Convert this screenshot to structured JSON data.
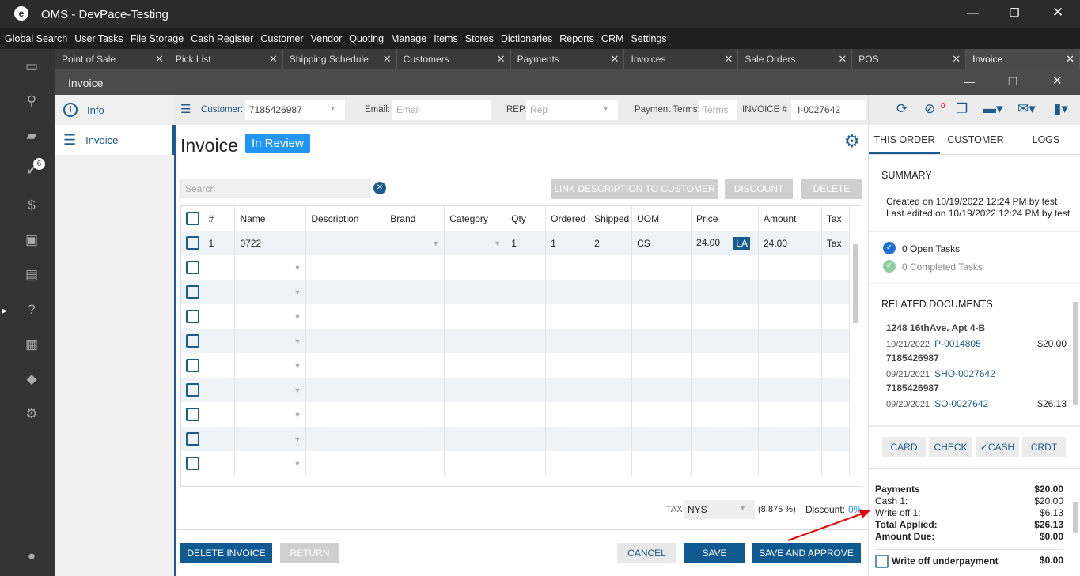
{
  "app": {
    "title": "OMS - DevPace-Testing"
  },
  "menu": [
    "Global Search",
    "User Tasks",
    "File Storage",
    "Cash Register",
    "Customer",
    "Vendor",
    "Quoting",
    "Manage",
    "Items",
    "Stores",
    "Dictionaries",
    "Reports",
    "CRM",
    "Settings"
  ],
  "tabs": [
    "Point of Sale",
    "Pick List",
    "Shipping Schedule",
    "Customers",
    "Payments",
    "Invoices",
    "Sale Orders",
    "POS",
    "Invoice"
  ],
  "sidebar_badge": "6",
  "window": {
    "title": "Invoice"
  },
  "nav": {
    "info": "Info",
    "invoice": "Invoice"
  },
  "toolbar": {
    "customer_label": "Customer:",
    "customer_value": "7185426987",
    "email_label": "Email:",
    "email_placeholder": "Email",
    "rep_label": "REP:",
    "rep_placeholder": "Rep",
    "terms_label": "Payment Terms:",
    "terms_placeholder": "Terms",
    "invoice_label": "INVOICE #",
    "invoice_value": "I-0027642"
  },
  "main": {
    "title": "Invoice",
    "status": "In Review",
    "search_placeholder": "Search",
    "link_desc": "LINK DESCRIPTION TO CUSTOMER",
    "discount": "DISCOUNT",
    "delete": "DELETE"
  },
  "table": {
    "headers": [
      "#",
      "Name",
      "Description",
      "Brand",
      "Category",
      "Qty",
      "Ordered",
      "Shipped",
      "UOM",
      "Price",
      "Amount",
      "Tax"
    ],
    "rows": [
      {
        "num": "1",
        "name": "0722",
        "description": "",
        "brand": "",
        "category": "",
        "qty": "1",
        "ordered": "1",
        "shipped": "2",
        "uom": "CS",
        "price": "24.00",
        "price_tag": "LA",
        "amount": "24.00",
        "tax": "Tax"
      }
    ]
  },
  "footer": {
    "tax_label": "TAX",
    "tax_value": "NYS",
    "tax_rate": "(8.875 %)",
    "discount_label": "Discount:",
    "discount_value": "0%",
    "delete_invoice": "DELETE INVOICE",
    "return": "RETURN",
    "cancel": "CANCEL",
    "save": "SAVE",
    "save_approve": "SAVE AND APPROVE"
  },
  "right": {
    "attach_count": "0",
    "tabs": [
      "THIS ORDER",
      "CUSTOMER",
      "LOGS"
    ],
    "summary_title": "SUMMARY",
    "created": "Created on 10/19/2022 12:24 PM by test",
    "edited": "Last edited on 10/19/2022 12:24 PM by test",
    "open_tasks": "0 Open Tasks",
    "completed_tasks": "0 Completed Tasks",
    "related_title": "RELATED DOCUMENTS",
    "related": [
      {
        "header": "1248 16thAve. Apt 4-B",
        "date": "10/21/2022",
        "doc": "P-0014805",
        "amount": "$20.00"
      },
      {
        "header": "7185426987",
        "date": "09/21/2021",
        "doc": "SHO-0027642",
        "amount": ""
      },
      {
        "header": "7185426987",
        "date": "09/20/2021",
        "doc": "SO-0027642",
        "amount": "$26.13"
      }
    ],
    "pay_buttons": [
      "CARD",
      "CHECK",
      "CASH",
      "CRDT"
    ],
    "payments_label": "Payments",
    "payments_total": "$20.00",
    "cash_label": "Cash 1:",
    "cash_value": "$20.00",
    "writeoff_label": "Write off 1:",
    "writeoff_value": "$6.13",
    "total_applied_label": "Total Applied:",
    "total_applied": "$26.13",
    "amount_due_label": "Amount Due:",
    "amount_due": "$0.00",
    "writeoff_under_label": "Write off underpayment",
    "writeoff_under_value": "$0.00"
  }
}
